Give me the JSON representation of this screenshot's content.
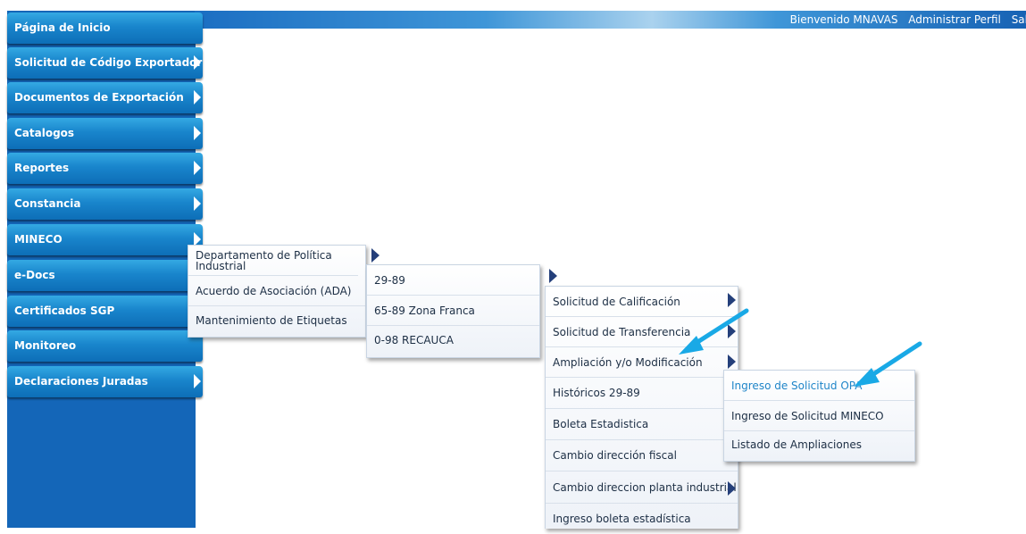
{
  "header": {
    "welcome": "Bienvenido MNAVAS",
    "profile_link": "Administrar Perfil",
    "logout_link": "Sal"
  },
  "sidebar": {
    "items": [
      {
        "label": "Página de Inicio"
      },
      {
        "label": "Solicitud de Código Exportador"
      },
      {
        "label": "Documentos de Exportación"
      },
      {
        "label": "Catalogos"
      },
      {
        "label": "Reportes"
      },
      {
        "label": "Constancia"
      },
      {
        "label": "MINECO"
      },
      {
        "label": "e-Docs"
      },
      {
        "label": "Certificados SGP"
      },
      {
        "label": "Monitoreo"
      },
      {
        "label": "Declaraciones Juradas"
      }
    ]
  },
  "menu_mineco": {
    "items": [
      {
        "label": "Departamento de Política Industrial"
      },
      {
        "label": "Acuerdo de Asociación (ADA)"
      },
      {
        "label": "Mantenimiento de Etiquetas"
      }
    ]
  },
  "menu_politica": {
    "items": [
      {
        "label": "29-89"
      },
      {
        "label": "65-89 Zona Franca"
      },
      {
        "label": "0-98 RECAUCA"
      }
    ]
  },
  "menu_2989": {
    "items": [
      {
        "label": "Solicitud de Calificación"
      },
      {
        "label": "Solicitud de Transferencia"
      },
      {
        "label": "Ampliación y/o Modificación"
      },
      {
        "label": "Históricos 29-89"
      },
      {
        "label": "Boleta Estadistica"
      },
      {
        "label": "Cambio dirección fiscal"
      },
      {
        "label": "Cambio direccion planta industrial"
      },
      {
        "label": "Ingreso boleta estadística"
      }
    ]
  },
  "menu_ampliacion": {
    "items": [
      {
        "label": "Ingreso de Solicitud OPA"
      },
      {
        "label": "Ingreso de Solicitud MINECO"
      },
      {
        "label": "Listado de Ampliaciones"
      }
    ]
  },
  "colors": {
    "sidebar_bg": "#1466b8",
    "menu_button": "#1985cc",
    "submenu_text": "#1c2e44",
    "active_text": "#1f85c8",
    "callout_arrow": "#19a9e6"
  }
}
